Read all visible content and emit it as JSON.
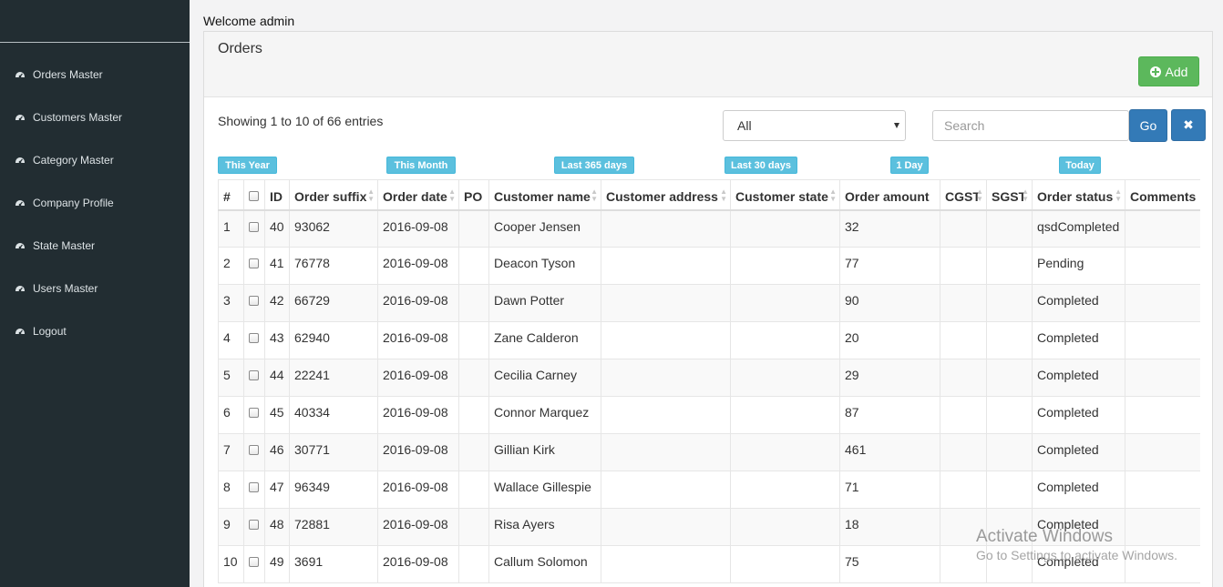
{
  "sidebar": {
    "items": [
      {
        "label": "Orders Master",
        "icon": "dashboard-icon"
      },
      {
        "label": "Customers Master",
        "icon": "dashboard-icon"
      },
      {
        "label": "Category Master",
        "icon": "dashboard-icon"
      },
      {
        "label": "Company Profile",
        "icon": "dashboard-icon"
      },
      {
        "label": "State Master",
        "icon": "dashboard-icon"
      },
      {
        "label": "Users Master",
        "icon": "dashboard-icon"
      },
      {
        "label": "Logout",
        "icon": "dashboard-icon"
      }
    ]
  },
  "header": {
    "welcome": "Welcome admin"
  },
  "panel": {
    "title": "Orders",
    "add_label": "Add"
  },
  "toolbar": {
    "showing": "Showing 1 to 10 of 66 entries",
    "filter_selected": "All",
    "search_placeholder": "Search",
    "go_label": "Go",
    "clear_icon": "times-icon"
  },
  "quick_filters": [
    "This Year",
    "This Month",
    "Last 365 days",
    "Last 30 days",
    "1 Day",
    "Today"
  ],
  "table": {
    "columns": [
      "#",
      "",
      "ID",
      "Order suffix",
      "Order date",
      "PO",
      "Customer name",
      "Customer address",
      "Customer state",
      "Order amount",
      "CGST",
      "SGST",
      "Order status",
      "Comments"
    ],
    "rows": [
      [
        "1",
        "",
        "40",
        "93062",
        "2016-09-08",
        "",
        "Cooper Jensen",
        "",
        "",
        "32",
        "",
        "",
        "qsdCompleted",
        ""
      ],
      [
        "2",
        "",
        "41",
        "76778",
        "2016-09-08",
        "",
        "Deacon Tyson",
        "",
        "",
        "77",
        "",
        "",
        "Pending",
        ""
      ],
      [
        "3",
        "",
        "42",
        "66729",
        "2016-09-08",
        "",
        "Dawn Potter",
        "",
        "",
        "90",
        "",
        "",
        "Completed",
        ""
      ],
      [
        "4",
        "",
        "43",
        "62940",
        "2016-09-08",
        "",
        "Zane Calderon",
        "",
        "",
        "20",
        "",
        "",
        "Completed",
        ""
      ],
      [
        "5",
        "",
        "44",
        "22241",
        "2016-09-08",
        "",
        "Cecilia Carney",
        "",
        "",
        "29",
        "",
        "",
        "Completed",
        ""
      ],
      [
        "6",
        "",
        "45",
        "40334",
        "2016-09-08",
        "",
        "Connor Marquez",
        "",
        "",
        "87",
        "",
        "",
        "Completed",
        ""
      ],
      [
        "7",
        "",
        "46",
        "30771",
        "2016-09-08",
        "",
        "Gillian Kirk",
        "",
        "",
        "461",
        "",
        "",
        "Completed",
        ""
      ],
      [
        "8",
        "",
        "47",
        "96349",
        "2016-09-08",
        "",
        "Wallace Gillespie",
        "",
        "",
        "71",
        "",
        "",
        "Completed",
        ""
      ],
      [
        "9",
        "",
        "48",
        "72881",
        "2016-09-08",
        "",
        "Risa Ayers",
        "",
        "",
        "18",
        "",
        "",
        "Completed",
        ""
      ],
      [
        "10",
        "",
        "49",
        "3691",
        "2016-09-08",
        "",
        "Callum Solomon",
        "",
        "",
        "75",
        "",
        "",
        "Completed",
        ""
      ]
    ]
  },
  "watermark": {
    "line1": "Activate Windows",
    "line2": "Go to Settings to activate Windows."
  },
  "colors": {
    "sidebar": "#222d32",
    "add": "#5cb85c",
    "primary": "#337ab7",
    "info": "#5bc0de"
  }
}
